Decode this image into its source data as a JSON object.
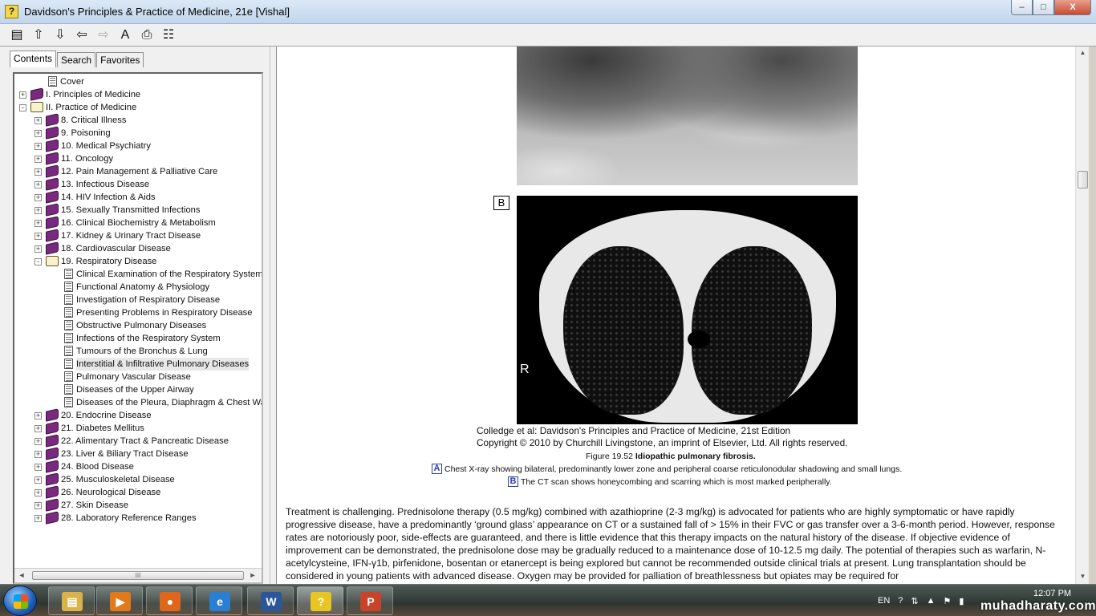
{
  "window": {
    "title": "Davidson's Principles & Practice of Medicine, 21e [Vishal]",
    "minimize": "–",
    "maximize": "□",
    "close": "X"
  },
  "toolbar": {
    "icons": [
      "hide-tabs-icon",
      "up-arrow-icon",
      "down-arrow-icon",
      "back-arrow-icon",
      "forward-arrow-icon",
      "font-size-icon",
      "print-icon",
      "options-icon"
    ],
    "glyphs": [
      "▤",
      "⇧",
      "⇩",
      "⇦",
      "⇨",
      "A",
      "⎙",
      "☷"
    ]
  },
  "tabs": [
    "Contents",
    "Search",
    "Favorites"
  ],
  "tree": [
    {
      "label": "Cover",
      "level": 1,
      "type": "page"
    },
    {
      "label": "I. Principles of Medicine",
      "level": 0,
      "type": "book",
      "exp": "+"
    },
    {
      "label": "II. Practice of Medicine",
      "level": 0,
      "type": "open",
      "exp": "-"
    },
    {
      "label": "8. Critical Illness",
      "level": 1,
      "type": "book",
      "exp": "+"
    },
    {
      "label": "9. Poisoning",
      "level": 1,
      "type": "book",
      "exp": "+"
    },
    {
      "label": "10. Medical Psychiatry",
      "level": 1,
      "type": "book",
      "exp": "+"
    },
    {
      "label": "11. Oncology",
      "level": 1,
      "type": "book",
      "exp": "+"
    },
    {
      "label": "12. Pain Management & Palliative Care",
      "level": 1,
      "type": "book",
      "exp": "+"
    },
    {
      "label": "13. Infectious Disease",
      "level": 1,
      "type": "book",
      "exp": "+"
    },
    {
      "label": "14. HIV Infection & Aids",
      "level": 1,
      "type": "book",
      "exp": "+"
    },
    {
      "label": "15. Sexually Transmitted Infections",
      "level": 1,
      "type": "book",
      "exp": "+"
    },
    {
      "label": "16. Clinical Biochemistry & Metabolism",
      "level": 1,
      "type": "book",
      "exp": "+"
    },
    {
      "label": "17. Kidney & Urinary Tract Disease",
      "level": 1,
      "type": "book",
      "exp": "+"
    },
    {
      "label": "18. Cardiovascular Disease",
      "level": 1,
      "type": "book",
      "exp": "+"
    },
    {
      "label": "19. Respiratory Disease",
      "level": 1,
      "type": "open",
      "exp": "-"
    },
    {
      "label": "Clinical Examination of the Respiratory System",
      "level": 2,
      "type": "page"
    },
    {
      "label": "Functional Anatomy & Physiology",
      "level": 2,
      "type": "page"
    },
    {
      "label": "Investigation of Respiratory Disease",
      "level": 2,
      "type": "page"
    },
    {
      "label": "Presenting Problems in Respiratory Disease",
      "level": 2,
      "type": "page"
    },
    {
      "label": "Obstructive Pulmonary Diseases",
      "level": 2,
      "type": "page"
    },
    {
      "label": "Infections of the Respiratory System",
      "level": 2,
      "type": "page"
    },
    {
      "label": "Tumours of the Bronchus & Lung",
      "level": 2,
      "type": "page"
    },
    {
      "label": "Interstitial & Infiltrative Pulmonary Diseases",
      "level": 2,
      "type": "page",
      "selected": true
    },
    {
      "label": "Pulmonary Vascular Disease",
      "level": 2,
      "type": "page"
    },
    {
      "label": "Diseases of the Upper Airway",
      "level": 2,
      "type": "page"
    },
    {
      "label": "Diseases of the Pleura, Diaphragm & Chest Wall",
      "level": 2,
      "type": "page"
    },
    {
      "label": "20. Endocrine Disease",
      "level": 1,
      "type": "book",
      "exp": "+"
    },
    {
      "label": "21. Diabetes Mellitus",
      "level": 1,
      "type": "book",
      "exp": "+"
    },
    {
      "label": "22. Alimentary Tract & Pancreatic Disease",
      "level": 1,
      "type": "book",
      "exp": "+"
    },
    {
      "label": "23. Liver & Biliary Tract Disease",
      "level": 1,
      "type": "book",
      "exp": "+"
    },
    {
      "label": "24. Blood Disease",
      "level": 1,
      "type": "book",
      "exp": "+"
    },
    {
      "label": "25. Musculoskeletal Disease",
      "level": 1,
      "type": "book",
      "exp": "+"
    },
    {
      "label": "26. Neurological Disease",
      "level": 1,
      "type": "book",
      "exp": "+"
    },
    {
      "label": "27. Skin Disease",
      "level": 1,
      "type": "book",
      "exp": "+"
    },
    {
      "label": "28. Laboratory Reference Ranges",
      "level": 1,
      "type": "book",
      "exp": "+"
    }
  ],
  "hscroll": {
    "left": "◄",
    "thumb": "III",
    "right": "►"
  },
  "content": {
    "label_b": "B",
    "ct_marker": "R",
    "caption1": "Colledge et al: Davidson's Principles and Practice of Medicine, 21st Edition",
    "caption2": "Copyright © 2010 by Churchill Livingstone, an imprint of Elsevier, Ltd. All rights reserved.",
    "figure_prefix": "Figure 19.52 ",
    "figure_title": "Idiopathic pulmonary fibrosis.",
    "legend": [
      {
        "key": "A",
        "text": "Chest X-ray showing bilateral, predominantly lower zone and peripheral coarse reticulonodular shadowing and small lungs."
      },
      {
        "key": "B",
        "text": "The CT scan shows honeycombing and scarring which is most marked peripherally."
      }
    ],
    "paragraph": "Treatment is challenging. Prednisolone therapy (0.5 mg/kg) combined with azathioprine (2-3 mg/kg) is advocated for patients who are highly symptomatic or have rapidly progressive disease, have a predominantly ‘ground glass’ appearance on CT or a sustained fall of > 15% in their FVC or gas transfer over a 3-6-month period. However, response rates are notoriously poor, side-effects are guaranteed, and there is little evidence that this therapy impacts on the natural history of the disease. If objective evidence of improvement can be demonstrated, the prednisolone dose may be gradually reduced to a maintenance dose of 10-12.5 mg daily. The potential of therapies such as warfarin, N-acetylcysteine, IFN-γ1b, pirfenidone, bosentan or etanercept is being explored but cannot be recommended outside clinical trials at present. Lung transplantation should be considered in young patients with advanced disease. Oxygen may be provided for palliation of breathlessness but opiates may be required for"
  },
  "vscroll": {
    "up": "▲",
    "down": "▼"
  },
  "taskbar": {
    "items": [
      {
        "name": "explorer",
        "glyph": "▤",
        "color": "#d9b24a"
      },
      {
        "name": "media-player",
        "glyph": "▶",
        "color": "#e07a1a"
      },
      {
        "name": "firefox",
        "glyph": "●",
        "color": "#e0661a"
      },
      {
        "name": "internet-explorer",
        "glyph": "e",
        "color": "#2a7fd4"
      },
      {
        "name": "word",
        "glyph": "W",
        "color": "#2b579a"
      },
      {
        "name": "help-viewer",
        "glyph": "?",
        "color": "#e8c520"
      },
      {
        "name": "powerpoint",
        "glyph": "P",
        "color": "#c8432a"
      }
    ],
    "lang": "EN",
    "tray_glyphs": [
      "?",
      "⇅",
      "▲",
      "⚑",
      "▮"
    ],
    "time": "12:07 PM",
    "watermark": "muhadharaty.com"
  }
}
